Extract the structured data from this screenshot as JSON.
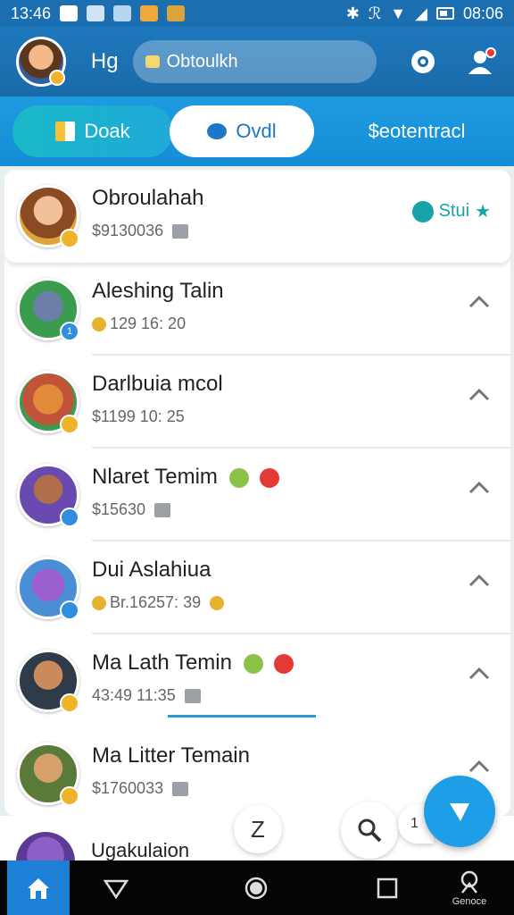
{
  "status_bar": {
    "time": "13:46",
    "clock": "08:06"
  },
  "header": {
    "name": "Hg",
    "search_text": "Obtoulkh",
    "colors": {
      "header": "#1a6aa8",
      "accent": "#1e9ee6"
    }
  },
  "tabs": [
    {
      "label": "Doak",
      "icon": "book-icon"
    },
    {
      "label": "Ovdl",
      "icon": "chat-icon"
    },
    {
      "label": "$eotentracl",
      "icon": ""
    }
  ],
  "chats": [
    {
      "name": "Obroulahah",
      "meta": "$9130036",
      "status": "Stui",
      "avatar_color": "#d98a3d",
      "badge_color": "#f0b429"
    },
    {
      "name": "Aleshing Talin",
      "meta": "129 16: 20",
      "avatar_color": "#3b9b4f",
      "badge_color": "#2f8ee0",
      "badge_text": "1"
    },
    {
      "name": "Darlbuia mcol",
      "meta": "$1199 10: 25",
      "avatar_color": "#c0533a",
      "badge_color": "#f0b429"
    },
    {
      "name": "Nlaret Temim",
      "meta": "$15630",
      "avatar_color": "#6a4ab0",
      "badge_color": "#2f8ee0"
    },
    {
      "name": "Dui Aslahiua",
      "meta": "Br.16257: 39",
      "avatar_color": "#7a3fb8",
      "badge_color": "#2f8ee0"
    },
    {
      "name": "Ma Lath Temin",
      "meta": "43:49 11:35",
      "avatar_color": "#2f3b49",
      "badge_color": "#f0b429"
    },
    {
      "name": "Ma Litter Temain",
      "meta": "$1760033",
      "avatar_color": "#5a7a3a",
      "badge_color": "#f0b429"
    }
  ],
  "peek": {
    "name": "Ugakulaion"
  },
  "floating": {
    "z_label": "Z",
    "side_label": "1"
  },
  "nav": {
    "profile_label": "Genoce"
  }
}
